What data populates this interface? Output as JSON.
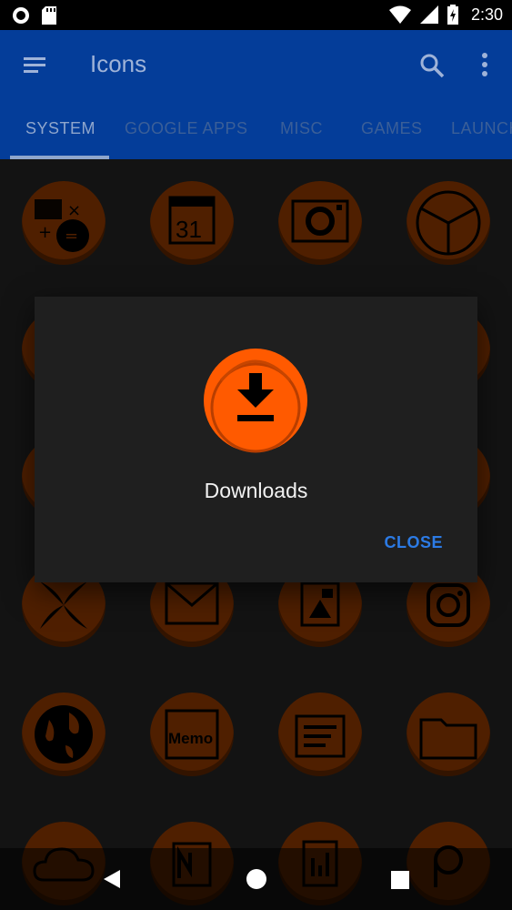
{
  "status_bar": {
    "time": "2:30",
    "icons": [
      "record-icon",
      "sd-card-icon",
      "wifi-icon",
      "signal-icon",
      "battery-charging-icon"
    ]
  },
  "app_bar": {
    "title": "Icons",
    "accent_color": "#043d99",
    "icons": [
      "menu-icon",
      "search-icon",
      "more-vert-icon"
    ]
  },
  "tabs": [
    {
      "label": "SYSTEM",
      "active": true
    },
    {
      "label": "GOOGLE APPS",
      "active": false
    },
    {
      "label": "MISC",
      "active": false
    },
    {
      "label": "GAMES",
      "active": false
    },
    {
      "label": "LAUNCH",
      "active": false
    }
  ],
  "grid": {
    "icon_color": "#ff5a00",
    "icons": [
      "calculator-icon",
      "calendar-icon",
      "camera-icon",
      "clock-icon",
      "contacts-icon",
      "dialer-icon",
      "email-icon",
      "files-icon",
      "gallery-icon",
      "messages-icon",
      "music-icon",
      "settings-icon",
      "photos-icon",
      "gmail-icon",
      "photo-editor-icon",
      "instagram-icon",
      "globe-icon",
      "memo-icon",
      "notes-icon",
      "folder-icon",
      "cloud-icon",
      "onenote-icon",
      "document-icon",
      "p-app-icon"
    ],
    "calendar_day": "31",
    "memo_label": "Memo"
  },
  "dialog": {
    "label": "Downloads",
    "icon": "download-icon",
    "close_label": "CLOSE",
    "close_color": "#2c7be5"
  },
  "nav_bar": {
    "icons": [
      "back-icon",
      "home-icon",
      "recents-icon"
    ]
  }
}
